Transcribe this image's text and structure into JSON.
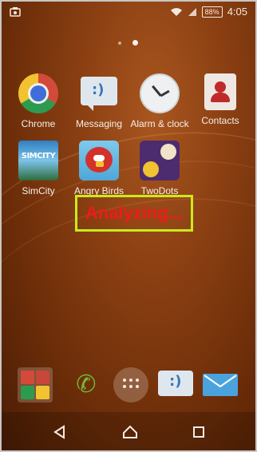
{
  "status_bar": {
    "battery_text": "88%",
    "time": "4:05",
    "icons": [
      "notification-icon",
      "wifi-icon",
      "signal-icon",
      "battery-icon"
    ]
  },
  "home": {
    "page_count": 2,
    "active_page": 2,
    "apps": [
      {
        "label": "Chrome",
        "icon": "chrome-icon"
      },
      {
        "label": "Messaging",
        "icon": "messaging-icon"
      },
      {
        "label": "Alarm & clock",
        "icon": "clock-icon"
      },
      {
        "label": "Contacts",
        "icon": "contacts-icon"
      },
      {
        "label": "SimCity",
        "icon": "simcity-icon",
        "icon_text": "SIMCITY"
      },
      {
        "label": "Angry Birds",
        "icon": "angry-birds-icon"
      },
      {
        "label": "TwoDots",
        "icon": "twodots-icon"
      }
    ]
  },
  "overlay": {
    "text": "Analyzing...",
    "border_color": "#c9ea1a",
    "text_color": "#ee1b1b"
  },
  "dock": {
    "items": [
      "google-folder-icon",
      "phone-icon",
      "app-drawer-icon",
      "messaging-icon",
      "email-icon"
    ]
  },
  "navbar": {
    "buttons": [
      "back-icon",
      "home-icon",
      "recents-icon"
    ]
  },
  "colors": {
    "wallpaper": "#8a3f12",
    "accent_blue": "#3a77b8"
  }
}
